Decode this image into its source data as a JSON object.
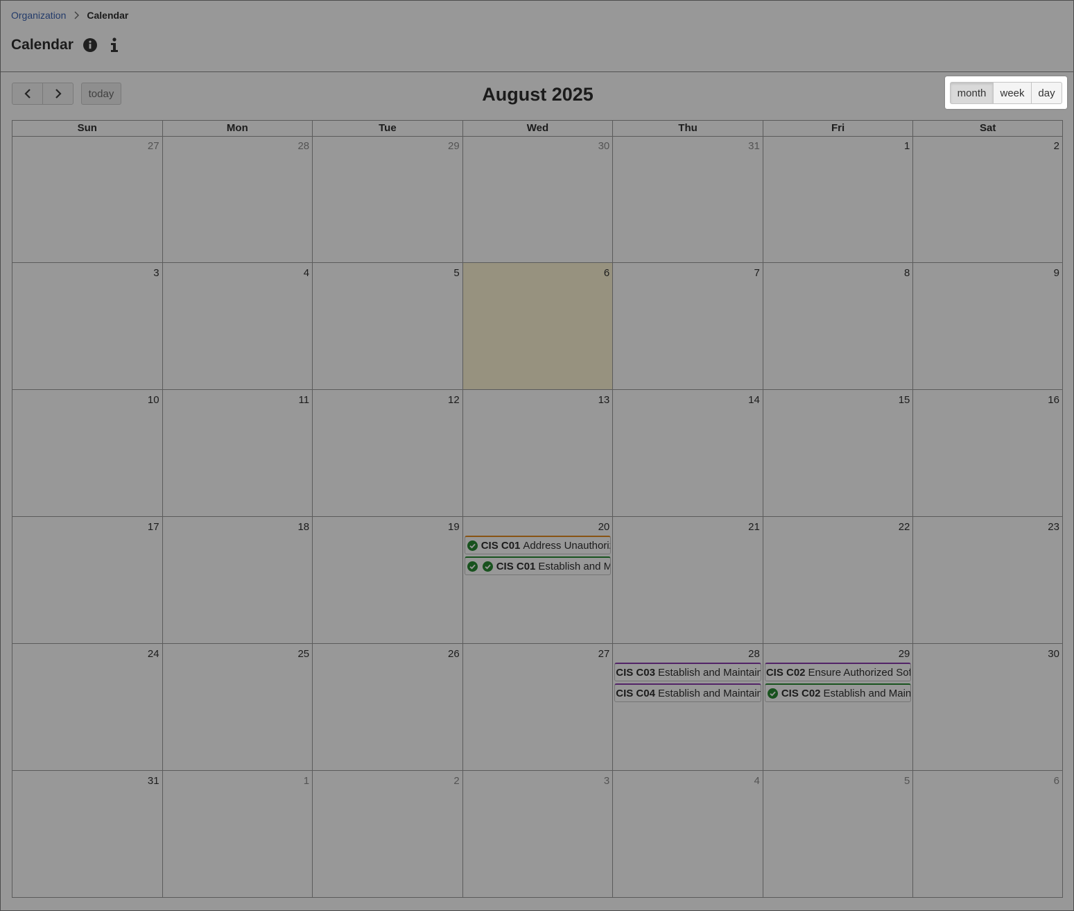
{
  "breadcrumb": {
    "parent": "Organization",
    "current": "Calendar"
  },
  "page": {
    "title": "Calendar"
  },
  "toolbar": {
    "today_label": "today",
    "title": "August 2025",
    "views": {
      "month": "month",
      "week": "week",
      "day": "day"
    },
    "active_view": "month"
  },
  "colors": {
    "today_bg": "#fdf4d0",
    "event_orange": "#e07b00",
    "event_green": "#0b7a16",
    "event_purple": "#7a1fa2",
    "check_green": "#0b7a16",
    "link": "#1f4ea8"
  },
  "icons": [
    "chevron-right-icon",
    "info-circle-icon",
    "info-icon",
    "chevron-left-icon",
    "chevron-right-icon",
    "check-circle-icon"
  ],
  "calendar": {
    "weekdays": [
      "Sun",
      "Mon",
      "Tue",
      "Wed",
      "Thu",
      "Fri",
      "Sat"
    ],
    "weeks": [
      {
        "days": [
          {
            "num": "27",
            "other": true
          },
          {
            "num": "28",
            "other": true
          },
          {
            "num": "29",
            "other": true
          },
          {
            "num": "30",
            "other": true
          },
          {
            "num": "31",
            "other": true
          },
          {
            "num": "1"
          },
          {
            "num": "2"
          }
        ]
      },
      {
        "days": [
          {
            "num": "3"
          },
          {
            "num": "4"
          },
          {
            "num": "5"
          },
          {
            "num": "6",
            "today": true
          },
          {
            "num": "7"
          },
          {
            "num": "8"
          },
          {
            "num": "9"
          }
        ]
      },
      {
        "days": [
          {
            "num": "10"
          },
          {
            "num": "11"
          },
          {
            "num": "12"
          },
          {
            "num": "13"
          },
          {
            "num": "14"
          },
          {
            "num": "15"
          },
          {
            "num": "16"
          }
        ]
      },
      {
        "days": [
          {
            "num": "17"
          },
          {
            "num": "18"
          },
          {
            "num": "19"
          },
          {
            "num": "20",
            "events": [
              {
                "code": "CIS C01",
                "desc": "Address Unauthoriz",
                "color": "orange",
                "checks": 1
              },
              {
                "code": "CIS C01",
                "desc": "Establish and Ma",
                "color": "green",
                "checks": 2
              }
            ]
          },
          {
            "num": "21"
          },
          {
            "num": "22"
          },
          {
            "num": "23"
          }
        ]
      },
      {
        "days": [
          {
            "num": "24"
          },
          {
            "num": "25"
          },
          {
            "num": "26"
          },
          {
            "num": "27"
          },
          {
            "num": "28",
            "events": [
              {
                "code": "CIS C03",
                "desc": "Establish and Maintain",
                "color": "purple",
                "checks": 0
              },
              {
                "code": "CIS C04",
                "desc": "Establish and Maintain",
                "color": "purple",
                "checks": 0
              }
            ]
          },
          {
            "num": "29",
            "events": [
              {
                "code": "CIS C02",
                "desc": "Ensure Authorized Sof",
                "color": "purple",
                "checks": 0
              },
              {
                "code": "CIS C02",
                "desc": "Establish and Maint",
                "color": "green",
                "checks": 1
              }
            ]
          },
          {
            "num": "30"
          }
        ]
      },
      {
        "days": [
          {
            "num": "31"
          },
          {
            "num": "1",
            "other": true
          },
          {
            "num": "2",
            "other": true
          },
          {
            "num": "3",
            "other": true
          },
          {
            "num": "4",
            "other": true
          },
          {
            "num": "5",
            "other": true
          },
          {
            "num": "6",
            "other": true
          }
        ]
      }
    ]
  }
}
